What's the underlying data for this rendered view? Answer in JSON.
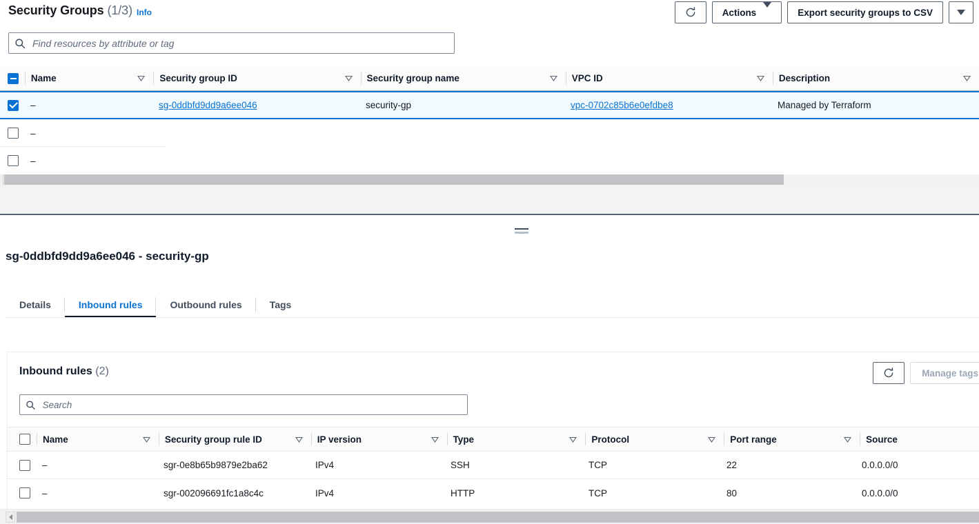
{
  "header": {
    "title": "Security Groups",
    "count": "(1/3)",
    "info_label": "Info",
    "refresh_icon": "refresh-icon",
    "actions_label": "Actions",
    "export_label": "Export security groups to CSV",
    "export_caret_icon": "chevron-down-icon"
  },
  "search": {
    "placeholder": "Find resources by attribute or tag",
    "value": "",
    "icon": "search-icon"
  },
  "table": {
    "columns": [
      {
        "label": "Name",
        "sortable": true
      },
      {
        "label": "Security group ID",
        "sortable": true
      },
      {
        "label": "Security group name",
        "sortable": true
      },
      {
        "label": "VPC ID",
        "sortable": true
      },
      {
        "label": "Description",
        "sortable": true
      }
    ],
    "select_all_state": "indeterminate",
    "rows": [
      {
        "selected": true,
        "name": "–",
        "sg_id": "sg-0ddbfd9dd9a6ee046",
        "sg_name": "security-gp",
        "vpc_id": "vpc-0702c85b6e0efdbe8",
        "description": "Managed by Terraform"
      },
      {
        "selected": false,
        "name": "–",
        "sg_id": "",
        "sg_name": "",
        "vpc_id": "",
        "description": ""
      },
      {
        "selected": false,
        "name": "–",
        "sg_id": "",
        "sg_name": "",
        "vpc_id": "",
        "description": ""
      }
    ]
  },
  "detail": {
    "title": "sg-0ddbfd9dd9a6ee046 - security-gp",
    "tabs": [
      {
        "label": "Details",
        "active": false
      },
      {
        "label": "Inbound rules",
        "active": true
      },
      {
        "label": "Outbound rules",
        "active": false
      },
      {
        "label": "Tags",
        "active": false
      }
    ]
  },
  "panel": {
    "title": "Inbound rules",
    "count": "(2)",
    "search_placeholder": "Search",
    "search_value": "",
    "refresh_icon": "refresh-icon",
    "manage_tags_label": "Manage tags",
    "manage_tags_disabled": true,
    "columns": [
      {
        "label": "Name",
        "sortable": true
      },
      {
        "label": "Security group rule ID",
        "sortable": true
      },
      {
        "label": "IP version",
        "sortable": true
      },
      {
        "label": "Type",
        "sortable": true
      },
      {
        "label": "Protocol",
        "sortable": true
      },
      {
        "label": "Port range",
        "sortable": true
      },
      {
        "label": "Source",
        "sortable": false
      }
    ],
    "rows": [
      {
        "name": "–",
        "rule_id": "sgr-0e8b65b9879e2ba62",
        "ip_version": "IPv4",
        "type": "SSH",
        "protocol": "TCP",
        "port_range": "22",
        "source": "0.0.0.0/0"
      },
      {
        "name": "–",
        "rule_id": "sgr-002096691fc1a8c4c",
        "ip_version": "IPv4",
        "type": "HTTP",
        "protocol": "TCP",
        "port_range": "80",
        "source": "0.0.0.0/0"
      }
    ]
  },
  "colors": {
    "link": "#0972d3",
    "selected_row_bg": "#f1faff",
    "accent": "#0972d3",
    "divider": "#53606d"
  }
}
